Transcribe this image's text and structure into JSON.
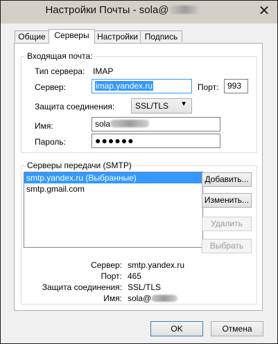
{
  "window": {
    "title_prefix": "Настройки Почты - sola@",
    "close_glyph": "✕"
  },
  "tabs": [
    {
      "label": "Общие"
    },
    {
      "label": "Серверы"
    },
    {
      "label": "Настройки"
    },
    {
      "label": "Подпись"
    }
  ],
  "incoming": {
    "caption": "Входящая почта:",
    "server_type_label": "Тип сервера:",
    "server_type_value": "IMAP",
    "server_label": "Сервер:",
    "server_value": "imap.yandex.ru",
    "port_label": "Порт:",
    "port_value": "993",
    "security_label": "Защита соединения:",
    "security_value": "SSL/TLS",
    "name_label": "Имя:",
    "name_value": "sola",
    "password_label": "Пароль:",
    "password_value": "●●●●●●"
  },
  "smtp": {
    "caption": "Серверы передачи (SMTP)",
    "servers": [
      {
        "label": "smtp.yandex.ru (Выбранные)"
      },
      {
        "label": "smtp.gmail.com"
      }
    ],
    "buttons": {
      "add": "Добавить...",
      "edit": "Изменить...",
      "delete": "Удалить",
      "select": "Выбрать"
    },
    "details": {
      "server_label": "Сервер:",
      "server_value": "smtp.yandex.ru",
      "port_label": "Порт:",
      "port_value": "465",
      "security_label": "Защита соединения:",
      "security_value": "SSL/TLS",
      "name_label": "Имя:",
      "name_value": "sola@"
    }
  },
  "footer": {
    "ok": "OK",
    "cancel": "Отмена"
  }
}
